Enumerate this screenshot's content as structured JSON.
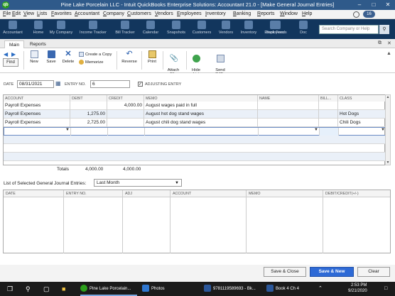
{
  "window": {
    "title": "Pine Lake Porcelain LLC  - Intuit QuickBooks Enterprise Solutions: Accountant 21.0 - [Make General Journal Entries]",
    "notification_count": "16"
  },
  "menu": [
    "File",
    "Edit",
    "View",
    "Lists",
    "Favorites",
    "Accountant",
    "Company",
    "Customers",
    "Vendors",
    "Employees",
    "Inventory",
    "Banking",
    "Reports",
    "Window",
    "Help"
  ],
  "iconbar": {
    "items": [
      "Accountant",
      "Home",
      "My Company",
      "Income Tracker",
      "Bill Tracker",
      "Calendar",
      "Snapshots",
      "Customers",
      "Vendors",
      "Inventory",
      "Employees",
      "Bank Feeds",
      "Doc"
    ],
    "search_placeholder": "Search Company or Help"
  },
  "tabs": [
    "Main",
    "Reports"
  ],
  "ribbon": {
    "find": "Find",
    "new": "New",
    "save": "Save",
    "delete": "Delete",
    "create_copy": "Create a Copy",
    "memorize": "Memorize",
    "reverse": "Reverse",
    "print": "Print",
    "attach_file": "Attach\nFile",
    "hide_list": "Hide\nList",
    "send_gjes": "Send\nGJEs"
  },
  "form": {
    "date_label": "DATE",
    "date_value": "08/31/2021",
    "entry_no_label": "ENTRY NO.",
    "entry_no_value": "6",
    "adjusting_label": "ADJUSTING ENTRY",
    "adjusting_checked": "✓"
  },
  "journal": {
    "headers": [
      "ACCOUNT",
      "DEBIT",
      "CREDIT",
      "MEMO",
      "NAME",
      "BILL...",
      "CLASS"
    ],
    "rows": [
      {
        "account": "Payroll Expenses",
        "debit": "",
        "credit": "4,000.00",
        "memo": "August wages paid in full",
        "name": "",
        "billable": "",
        "class": ""
      },
      {
        "account": "Payroll Expenses",
        "debit": "1,275.00",
        "credit": "",
        "memo": "August hot dog stand wages",
        "name": "",
        "billable": "",
        "class": "Hot Dogs"
      },
      {
        "account": "Payroll Expenses",
        "debit": "2,725.00",
        "credit": "",
        "memo": "August chili dog stand wages",
        "name": "",
        "billable": "",
        "class": "Chili Dogs"
      }
    ],
    "totals_label": "Totals",
    "total_debit": "4,000.00",
    "total_credit": "4,000.00"
  },
  "lower": {
    "list_label": "List of Selected General Journal Entries:",
    "period": "Last Month",
    "headers": [
      "DATE",
      "ENTRY NO.",
      "ADJ",
      "ACCOUNT",
      "MEMO",
      "DEBIT/CREDIT(+/-)"
    ]
  },
  "buttons": {
    "save_close": "Save & Close",
    "save_new": "Save & New",
    "clear": "Clear"
  },
  "taskbar": {
    "apps": [
      "Pine Lake Porcelain...",
      "Photos",
      "9781119589693 - Bk...",
      "Book 4 Ch 4"
    ],
    "time": "2:53 PM",
    "date": "9/21/2020"
  }
}
